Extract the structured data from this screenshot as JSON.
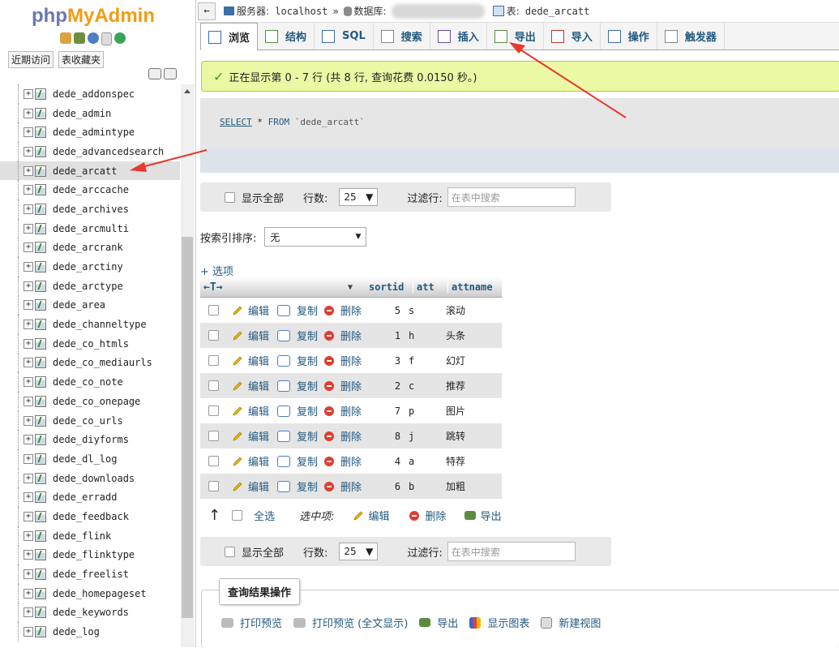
{
  "app": {
    "logo_php": "php",
    "logo_myadmin": "MyAdmin"
  },
  "nav": {
    "recent": "近期访问",
    "favorites": "表收藏夹"
  },
  "tree": {
    "items": [
      "dede_addonspec",
      "dede_admin",
      "dede_admintype",
      "dede_advancedsearch",
      "dede_arcatt",
      "dede_arccache",
      "dede_archives",
      "dede_arcmulti",
      "dede_arcrank",
      "dede_arctiny",
      "dede_arctype",
      "dede_area",
      "dede_channeltype",
      "dede_co_htmls",
      "dede_co_mediaurls",
      "dede_co_note",
      "dede_co_onepage",
      "dede_co_urls",
      "dede_diyforms",
      "dede_dl_log",
      "dede_downloads",
      "dede_erradd",
      "dede_feedback",
      "dede_flink",
      "dede_flinktype",
      "dede_freelist",
      "dede_homepageset",
      "dede_keywords",
      "dede_log"
    ],
    "selected": "dede_arcatt"
  },
  "breadcrumb": {
    "server_label": "服务器:",
    "server": "localhost",
    "sep": "»",
    "db_label": "数据库:",
    "table_label": "表:",
    "table": "dede_arcatt"
  },
  "tabs": [
    {
      "label": "浏览",
      "icon": "browse-icon"
    },
    {
      "label": "结构",
      "icon": "structure-icon"
    },
    {
      "label": "SQL",
      "icon": "sql-icon"
    },
    {
      "label": "搜索",
      "icon": "search-icon"
    },
    {
      "label": "插入",
      "icon": "insert-icon"
    },
    {
      "label": "导出",
      "icon": "export-icon"
    },
    {
      "label": "导入",
      "icon": "import-icon"
    },
    {
      "label": "操作",
      "icon": "wrench-icon"
    },
    {
      "label": "触发器",
      "icon": "trigger-icon"
    }
  ],
  "message": "正在显示第 0 - 7 行 (共 8 行, 查询花费 0.0150 秒。)",
  "sql": {
    "select": "SELECT",
    "star": " * ",
    "from": "FROM",
    "table": " `dede_arcatt`"
  },
  "navbar": {
    "show_all": "显示全部",
    "rows_label": "行数:",
    "rows_value": "25",
    "filter_label": "过滤行:",
    "filter_placeholder": "在表中搜索"
  },
  "sort": {
    "label": "按索引排序:",
    "value": "无"
  },
  "options_label": "+ 选项",
  "columns": [
    "sortid",
    "att",
    "attname"
  ],
  "row_actions": {
    "edit": "编辑",
    "copy": "复制",
    "delete": "删除"
  },
  "rows": [
    {
      "sortid": "5",
      "att": "s",
      "attname": "滚动"
    },
    {
      "sortid": "1",
      "att": "h",
      "attname": "头条"
    },
    {
      "sortid": "3",
      "att": "f",
      "attname": "幻灯"
    },
    {
      "sortid": "2",
      "att": "c",
      "attname": "推荐"
    },
    {
      "sortid": "7",
      "att": "p",
      "attname": "图片"
    },
    {
      "sortid": "8",
      "att": "j",
      "attname": "跳转"
    },
    {
      "sortid": "4",
      "att": "a",
      "attname": "特荐"
    },
    {
      "sortid": "6",
      "att": "b",
      "attname": "加粗"
    }
  ],
  "bulk": {
    "check_all": "全选",
    "with_selected": "选中项:",
    "edit": "编辑",
    "delete": "删除",
    "export": "导出"
  },
  "query_ops": {
    "legend": "查询结果操作",
    "print": "打印预览",
    "print_full": "打印预览 (全文显示)",
    "export": "导出",
    "chart": "显示图表",
    "view": "新建视图"
  }
}
